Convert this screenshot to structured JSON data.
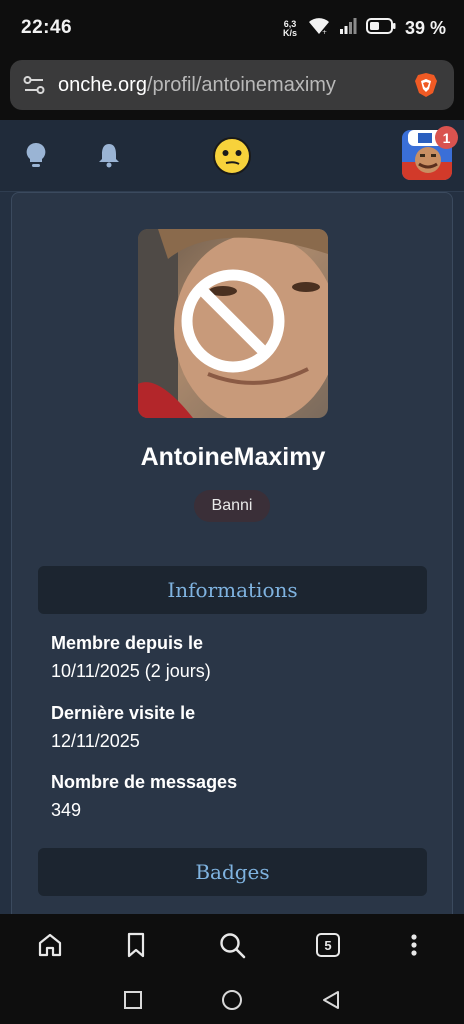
{
  "status_bar": {
    "time": "22:46",
    "net_speed_top": "6,3",
    "net_speed_bottom": "K/s",
    "battery_percent": "39 %"
  },
  "browser": {
    "url_domain": "onche.org",
    "url_path": "/profil/antoinemaximy",
    "tab_count": "5"
  },
  "header": {
    "notification_count": "1"
  },
  "profile": {
    "username": "AntoineMaximy",
    "status": "Banni"
  },
  "sections": {
    "informations_title": "Informations",
    "badges_title": "Badges"
  },
  "info": {
    "member_since_label": "Membre depuis le",
    "member_since_value": "10/11/2025 (2 jours)",
    "last_visit_label": "Dernière visite le",
    "last_visit_value": "12/11/2025",
    "message_count_label": "Nombre de messages",
    "message_count_value": "349"
  },
  "colors": {
    "page_bg": "#243041",
    "card_bg": "#2a3647",
    "section_head_bg": "#1c2530",
    "section_title": "#7fb3e0",
    "ban_badge_bg": "#3a2f38",
    "notification_badge": "#d9534f"
  }
}
